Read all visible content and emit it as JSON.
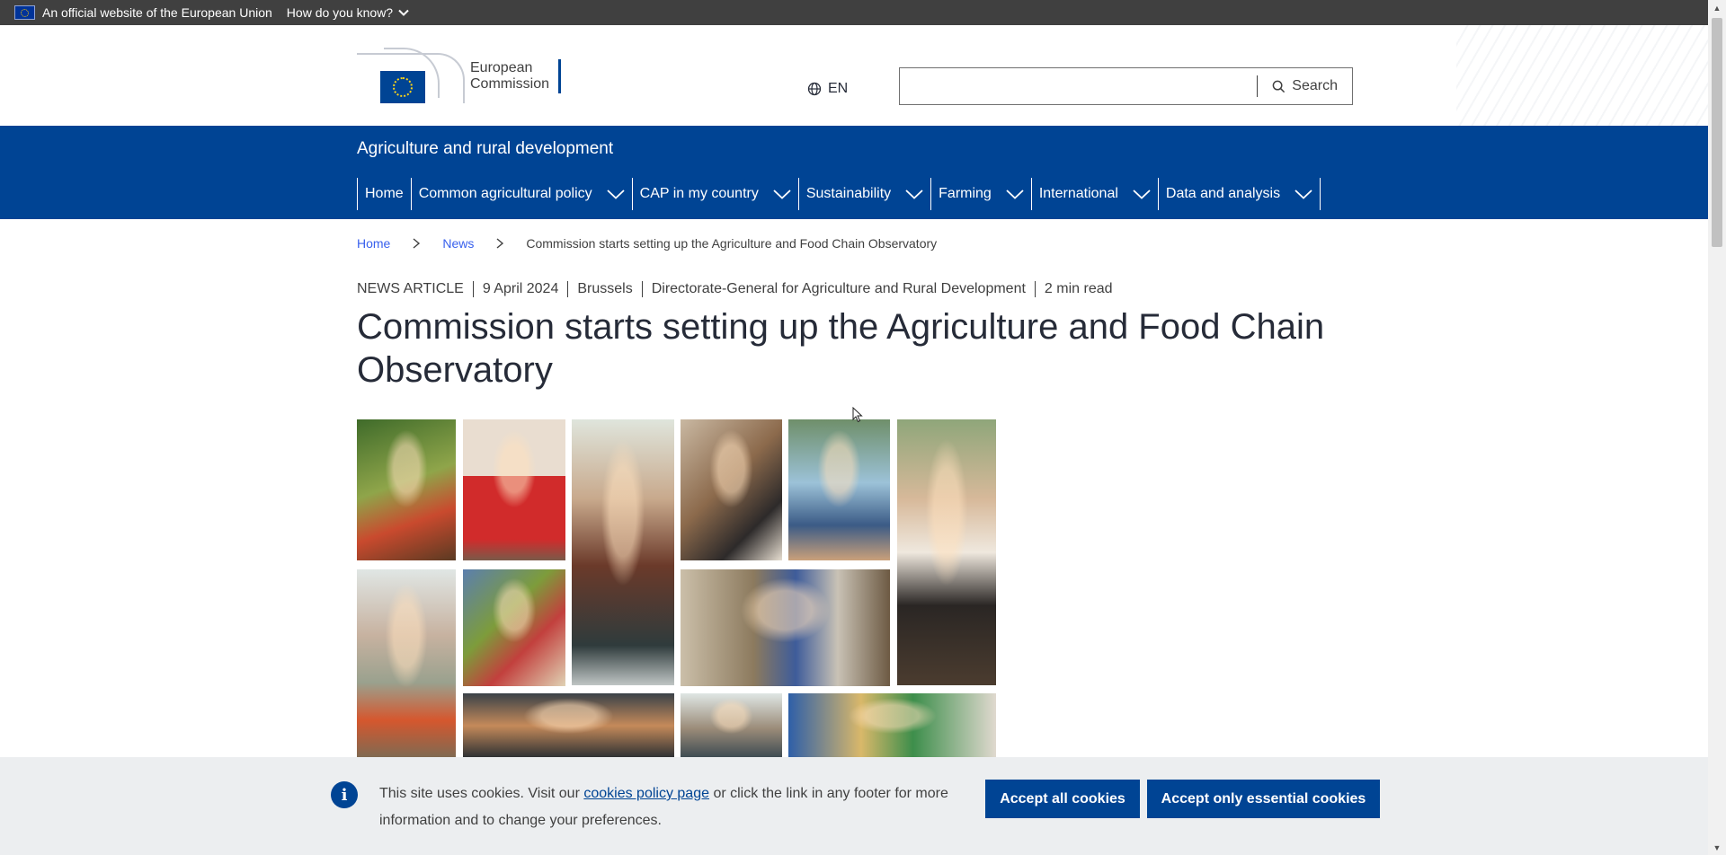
{
  "eu_bar": {
    "official_text": "An official website of the European Union",
    "how_label": "How do you know?"
  },
  "header": {
    "logo_line1": "European",
    "logo_line2": "Commission",
    "language": "EN",
    "search_placeholder": "",
    "search_button": "Search"
  },
  "site": {
    "title": "Agriculture and rural development"
  },
  "nav": {
    "items": [
      {
        "label": "Home"
      },
      {
        "label": "Common agricultural policy"
      },
      {
        "label": "CAP in my country"
      },
      {
        "label": "Sustainability"
      },
      {
        "label": "Farming"
      },
      {
        "label": "International"
      },
      {
        "label": "Data and analysis"
      }
    ]
  },
  "breadcrumb": {
    "home": "Home",
    "news": "News",
    "current": "Commission starts setting up the Agriculture and Food Chain Observatory"
  },
  "article": {
    "type": "NEWS ARTICLE",
    "date": "9 April 2024",
    "location": "Brussels",
    "department": "Directorate-General for Agriculture and Rural Development",
    "read_time": "2 min read",
    "title": "Commission starts setting up the Agriculture and Food Chain Observatory"
  },
  "cookie": {
    "text_before": "This site uses cookies. Visit our ",
    "link": "cookies policy page",
    "text_after": " or click the link in any footer for more information and to change your preferences.",
    "accept_all": "Accept all cookies",
    "accept_essential": "Accept only essential cookies"
  },
  "colors": {
    "brand_blue": "#004494",
    "top_bar": "#404040",
    "link_blue": "#3860ed",
    "cookie_bg": "#eceef0"
  }
}
